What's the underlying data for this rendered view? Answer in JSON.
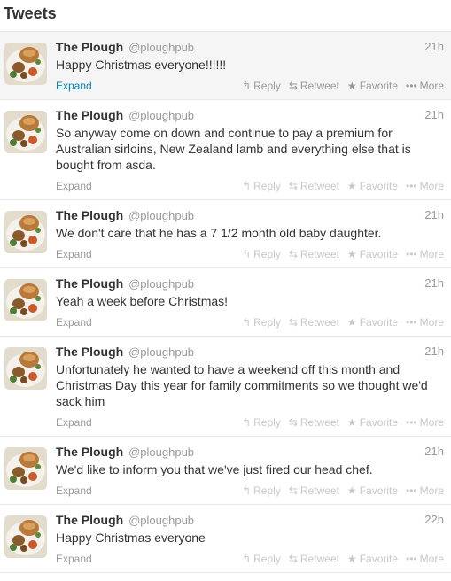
{
  "stream": {
    "title": "Tweets"
  },
  "tweets": [
    {
      "name": "The Plough",
      "handle": "@ploughpub",
      "time": "21h",
      "text": "Happy Christmas everyone!!!!!!",
      "expand": "Expand"
    },
    {
      "name": "The Plough",
      "handle": "@ploughpub",
      "time": "21h",
      "text": "So anyway come on down and continue to pay a premium for Australian sirloins, New Zealand lamb and everything else that is bought from asda.",
      "expand": "Expand"
    },
    {
      "name": "The Plough",
      "handle": "@ploughpub",
      "time": "21h",
      "text": "We don't care that he has a 7 1/2 month old baby daughter.",
      "expand": "Expand"
    },
    {
      "name": "The Plough",
      "handle": "@ploughpub",
      "time": "21h",
      "text": "Yeah a week before Christmas!",
      "expand": "Expand"
    },
    {
      "name": "The Plough",
      "handle": "@ploughpub",
      "time": "21h",
      "text": "Unfortunately he wanted to have a weekend off this month and Christmas Day this year for family commitments so we thought we'd sack him",
      "expand": "Expand"
    },
    {
      "name": "The Plough",
      "handle": "@ploughpub",
      "time": "21h",
      "text": "We'd like to inform you that we've just fired our head chef.",
      "expand": "Expand"
    },
    {
      "name": "The Plough",
      "handle": "@ploughpub",
      "time": "22h",
      "text": "Happy Christmas everyone",
      "expand": "Expand"
    }
  ],
  "actions": {
    "reply": "Reply",
    "retweet": "Retweet",
    "favorite": "Favorite",
    "more": "More"
  },
  "icons": {
    "reply": "reply-arrow-icon",
    "retweet": "retweet-icon",
    "favorite": "star-icon",
    "more": "ellipsis-icon"
  },
  "colors": {
    "link_blue": "#0084b4",
    "hover_background": "#f5f5f5",
    "muted_gray": "#999999",
    "faded_action": "#c8c8c8"
  }
}
